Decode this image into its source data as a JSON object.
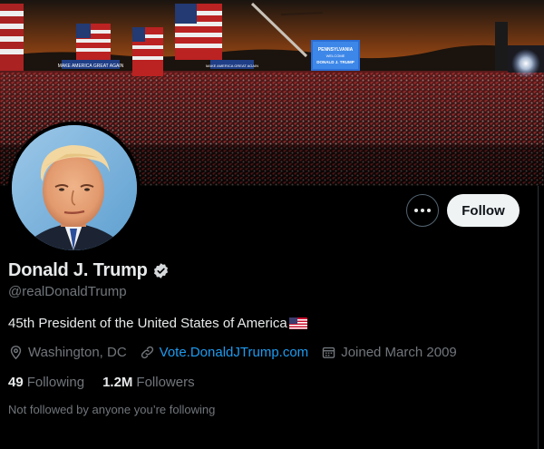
{
  "profile": {
    "display_name": "Donald J. Trump",
    "handle": "@realDonaldTrump",
    "bio": "45th President of the United States of America",
    "bio_emoji": "us-flag-icon",
    "location": "Washington, DC",
    "website": "Vote.DonaldJTrump.com",
    "joined": "Joined March 2009",
    "following_count": "49",
    "following_label": "Following",
    "followers_count": "1.2M",
    "followers_label": "Followers",
    "followed_by_text": "Not followed by anyone you’re following",
    "verified": true
  },
  "actions": {
    "more_icon": "more-dots-icon",
    "follow_label": "Follow"
  },
  "banner": {
    "screen_line1": "PENNSYLVANIA",
    "screen_line2": "WELCOME",
    "screen_line3": "DONALD J. TRUMP",
    "sign_left": "MAKE AMERICA GREAT AGAIN",
    "sign_right": "MAKE AMERICA GREAT AGAIN"
  },
  "colors": {
    "background": "#000000",
    "primary_text": "#e7e9ea",
    "secondary_text": "#71767b",
    "link": "#1d9bf0",
    "follow_button_bg": "#eff3f4"
  }
}
